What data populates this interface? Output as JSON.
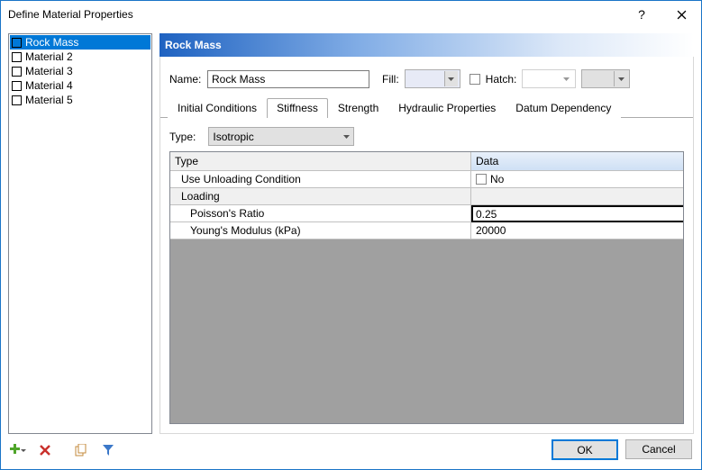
{
  "window": {
    "title": "Define Material Properties"
  },
  "sidebar": {
    "items": [
      {
        "label": "Rock Mass",
        "color": "#e7eaff",
        "selected": true
      },
      {
        "label": "Material 2",
        "color": "#55a028",
        "selected": false
      },
      {
        "label": "Material 3",
        "color": "#c8f0ff",
        "selected": false
      },
      {
        "label": "Material 4",
        "color": "#f5b800",
        "selected": false
      },
      {
        "label": "Material 5",
        "color": "#ffd7e0",
        "selected": false
      }
    ]
  },
  "panel": {
    "heading": "Rock Mass",
    "name_label": "Name:",
    "name_value": "Rock Mass",
    "fill_label": "Fill:",
    "hatch_label": "Hatch:"
  },
  "tabs": [
    {
      "label": "Initial Conditions"
    },
    {
      "label": "Stiffness"
    },
    {
      "label": "Strength"
    },
    {
      "label": "Hydraulic Properties"
    },
    {
      "label": "Datum Dependency"
    }
  ],
  "active_tab_index": 1,
  "stiffness": {
    "type_label": "Type:",
    "type_value": "Isotropic",
    "grid": {
      "col_type": "Type",
      "col_data": "Data",
      "row_unload_label": "Use Unloading Condition",
      "row_unload_value": "No",
      "group_loading": "Loading",
      "row_poisson_label": "Poisson's Ratio",
      "row_poisson_value": "0.25",
      "row_young_label": "Young's Modulus (kPa)",
      "row_young_value": "20000"
    }
  },
  "buttons": {
    "ok": "OK",
    "cancel": "Cancel"
  }
}
